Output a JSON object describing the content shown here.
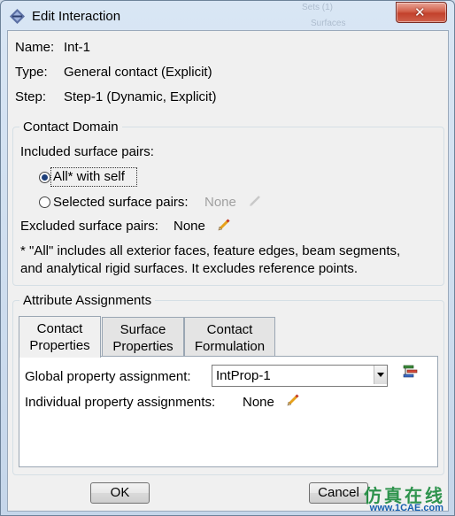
{
  "window": {
    "title": "Edit Interaction",
    "close_symbol": "✕",
    "background_ghost_1": "Sets (1)",
    "background_ghost_2": "Surfaces"
  },
  "info": {
    "name_label": "Name:",
    "name_value": "Int-1",
    "type_label": "Type:",
    "type_value": "General contact (Explicit)",
    "step_label": "Step:",
    "step_value": "Step-1 (Dynamic, Explicit)"
  },
  "contact_domain": {
    "title": "Contact Domain",
    "included_label": "Included surface pairs:",
    "option_all": "All* with self",
    "option_selected": "Selected surface pairs:",
    "selected_value": "None",
    "excluded_label": "Excluded surface pairs:",
    "excluded_value": "None",
    "note_line1": "* \"All\" includes all exterior faces, feature edges, beam segments,",
    "note_line2": "and analytical rigid surfaces. It excludes reference points."
  },
  "attribute_assignments": {
    "title": "Attribute Assignments",
    "tabs": [
      {
        "line1": "Contact",
        "line2": "Properties"
      },
      {
        "line1": "Surface",
        "line2": "Properties"
      },
      {
        "line1": "Contact",
        "line2": "Formulation"
      }
    ],
    "global_label": "Global property assignment:",
    "global_value": "IntProp-1",
    "individual_label": "Individual property assignments:",
    "individual_value": "None"
  },
  "buttons": {
    "ok": "OK",
    "cancel": "Cancel"
  },
  "watermark": {
    "chinese": "仿真在线",
    "url": "www.1CAE.com"
  },
  "colors": {
    "radio_selected": "#1d3f7a",
    "close_button": "#c2412c",
    "watermark_green": "#1a8a3c",
    "watermark_blue": "#1760b0"
  }
}
